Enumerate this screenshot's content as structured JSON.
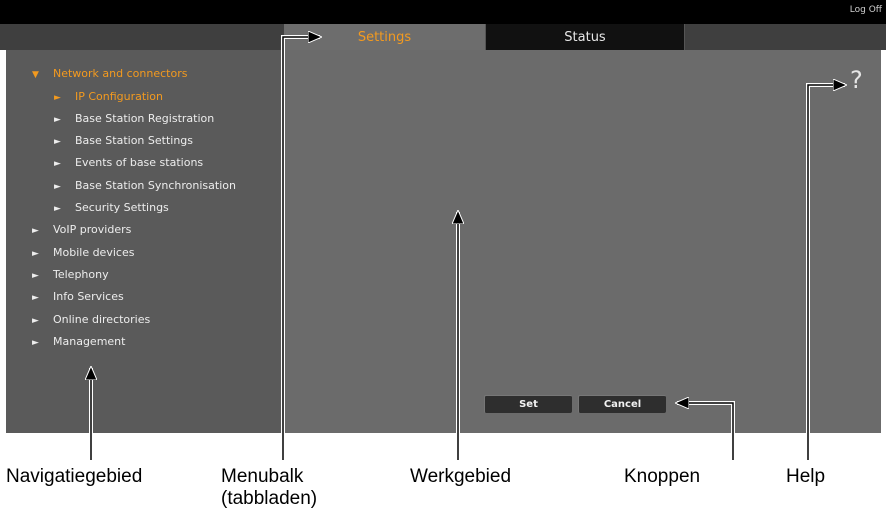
{
  "header": {
    "logoff_label": "Log Off"
  },
  "tabs": [
    {
      "label": "Settings",
      "active": true
    },
    {
      "label": "Status",
      "active": false
    }
  ],
  "nav": {
    "items": [
      {
        "label": "Network and connectors",
        "marker": "▼",
        "active": true
      },
      {
        "label": "IP Configuration",
        "marker": "►",
        "active": true
      },
      {
        "label": "Base Station Registration",
        "marker": "►"
      },
      {
        "label": "Base Station Settings",
        "marker": "►"
      },
      {
        "label": "Events of base stations",
        "marker": "►"
      },
      {
        "label": "Base Station Synchronisation",
        "marker": "►"
      },
      {
        "label": "Security Settings",
        "marker": "►"
      },
      {
        "label": "VoIP providers",
        "marker": "►"
      },
      {
        "label": "Mobile devices",
        "marker": "►"
      },
      {
        "label": "Telephony",
        "marker": "►"
      },
      {
        "label": "Info Services",
        "marker": "►"
      },
      {
        "label": "Online directories",
        "marker": "►"
      },
      {
        "label": "Management",
        "marker": "►"
      }
    ]
  },
  "help": {
    "symbol": "?"
  },
  "buttons": {
    "set_label": "Set",
    "cancel_label": "Cancel"
  },
  "captions": {
    "navigation": "Navigatiegebied",
    "menubar_line1": "Menubalk",
    "menubar_line2": "(tabbladen)",
    "workarea": "Werkgebied",
    "buttons": "Knoppen",
    "help": "Help"
  },
  "colors": {
    "accent": "#f39a1f",
    "nav_bg": "#5a5a5a",
    "work_bg": "#6b6b6b",
    "topbar": "#000000"
  }
}
